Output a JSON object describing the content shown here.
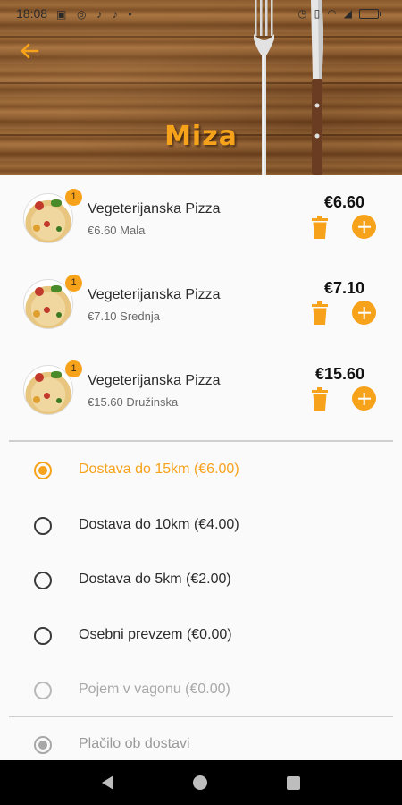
{
  "status_bar": {
    "time": "18:08"
  },
  "header": {
    "title": "Miza"
  },
  "cart": {
    "items": [
      {
        "name": "Vegeterijanska Pizza",
        "subtitle": "€6.60 Mala",
        "price": "€6.60",
        "quantity": "1"
      },
      {
        "name": "Vegeterijanska Pizza",
        "subtitle": "€7.10 Srednja",
        "price": "€7.10",
        "quantity": "1"
      },
      {
        "name": "Vegeterijanska Pizza",
        "subtitle": "€15.60 Družinska",
        "price": "€15.60",
        "quantity": "1"
      }
    ]
  },
  "delivery": {
    "options": [
      {
        "label": "Dostava do 15km (€6.00)",
        "state": "selected"
      },
      {
        "label": "Dostava do 10km (€4.00)",
        "state": "normal"
      },
      {
        "label": "Dostava do 5km (€2.00)",
        "state": "normal"
      },
      {
        "label": "Osebni prevzem (€0.00)",
        "state": "normal"
      },
      {
        "label": "Pojem v vagonu (€0.00)",
        "state": "disabled"
      }
    ]
  },
  "payment": {
    "label": "Plačilo ob dostavi",
    "state": "selected-disabled"
  },
  "colors": {
    "accent": "#f7a21b",
    "text": "#2b2b2b",
    "muted": "#a8a8a8",
    "navbar": "#000000"
  },
  "icons": {
    "back": "arrow-left-icon",
    "trash": "trash-icon",
    "plus": "plus-circle-icon",
    "nav_back": "nav-back-icon",
    "nav_home": "nav-home-icon",
    "nav_recent": "nav-recent-icon"
  }
}
